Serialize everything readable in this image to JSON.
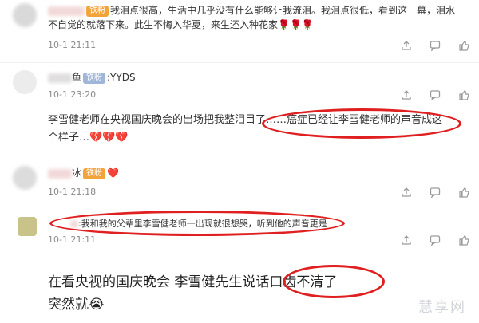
{
  "comments": [
    {
      "badge": "铁粉",
      "text": "我泪点很高，生活中几乎没有什么能够让我流泪。我泪点很低，看到这一幕，泪水不自觉的就落下来。此生不悔入华夏，来生还入种花家🌹🌹🌹",
      "time": "10-1 21:11"
    },
    {
      "name_suffix": "鱼",
      "badge": "铁粉",
      "badge_text": ":YYDS",
      "time": "10-1 23:20",
      "body": "李雪健老师在央视国庆晚会的出场把我整泪目了……癌症已经让李雪健老师的声音成这个样子…💔💔💔"
    },
    {
      "name_suffix": "冰",
      "badge": "铁粉",
      "heart": "❤️",
      "time": "10-1 21:18",
      "reply": "我和我的父辈里李雪健老师一出现就很想哭，听到他的声音更是",
      "reply_time": "10-1 21:11"
    }
  ],
  "caption": {
    "line1": "在看央视的国庆晚会 李雪健先生说话口齿不清了",
    "line2": "突然就😭"
  },
  "icons": [
    "share-icon",
    "comment-icon",
    "like-icon"
  ],
  "watermark": "慧享网",
  "colors": {
    "highlight": "#e02020",
    "badge": "#9fb6d8"
  }
}
